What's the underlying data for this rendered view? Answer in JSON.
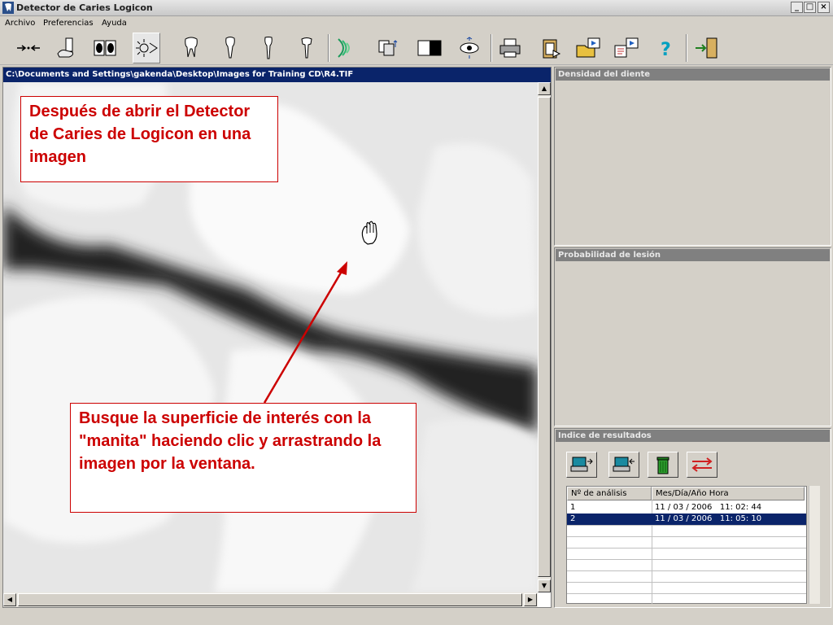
{
  "window": {
    "title": "Detector de Caries Logicon",
    "min_glyph": "_",
    "max_glyph": "□",
    "close_glyph": "×"
  },
  "menu": {
    "items": [
      "Archivo",
      "Preferencias",
      "Ayuda"
    ]
  },
  "toolbar": {
    "buttons": [
      "arrows-tool-icon",
      "calibrate-hand-icon",
      "compare-images-icon",
      "light-analysis-icon",
      "molar-tooth-icon",
      "single-root-tooth-icon",
      "premolar-tooth-icon",
      "canine-tooth-icon",
      "density-wave-icon",
      "transfer-image-icon",
      "contrast-toggle-icon",
      "view-eye-icon",
      "print-icon",
      "clipboard-icon",
      "open-folder-icon",
      "export-report-icon",
      "help-icon",
      "exit-door-icon"
    ]
  },
  "image_window": {
    "path": "C:\\Documents and Settings\\gakenda\\Desktop\\Images for Training CD\\R4.TIF"
  },
  "callouts": {
    "first": "Después de abrir el Detector de Caries de Logicon en una imagen",
    "second": "Busque la superficie de interés con la \"manita\" haciendo clic y arrastrando la imagen por la ventana."
  },
  "panels": {
    "density_title": "Densidad del diente",
    "probability_title": "Probabilidad de lesión",
    "results_title": "Indice de resultados"
  },
  "results": {
    "buttons": [
      "load-result-icon",
      "save-result-icon",
      "delete-trash-icon",
      "compare-arrows-icon"
    ],
    "columns": [
      "Nº de análisis",
      "Mes/Día/Año  Hora"
    ],
    "rows": [
      {
        "num": "1",
        "datetime": "11 / 03 / 2006   11: 02: 44",
        "selected": false
      },
      {
        "num": "2",
        "datetime": "11 / 03 / 2006   11: 05: 10",
        "selected": true
      }
    ]
  },
  "colors": {
    "title_blue": "#0a246a",
    "callout_red": "#cc0000",
    "panel_gray": "#808080"
  }
}
